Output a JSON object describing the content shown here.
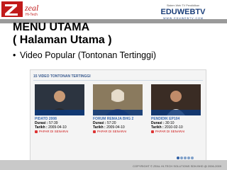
{
  "logos": {
    "left_text": "zeal",
    "left_sub": "Hi-Tech",
    "left_company": "ZEAL HI-TECH SOLUTIONS SDN. BHD.",
    "right_tagline": "Sistem Web TV Pendidikan",
    "right_brand": "EDUWEBTV",
    "right_url": "W W W . E D U W E B T V . C O M"
  },
  "slide": {
    "title_line1": "MENU UTAMA",
    "title_line2": "( Halaman Utama )",
    "bullet": "Video Popular (Tontonan Tertinggi)"
  },
  "screenshot": {
    "section_header": "15 VIDEO TONTONAN TERTINGGI",
    "cards": [
      {
        "title": "PIDATO 2008",
        "duration_label": "Durasi :",
        "duration": "57:39",
        "date_label": "Tarikh :",
        "date": "2009-04-10",
        "play_label": "PAPAR DI SENARAI"
      },
      {
        "title": "FORUM REMAJA BHG 2",
        "duration_label": "Durasi :",
        "duration": "57:20",
        "date_label": "Tarikh :",
        "date": "2009-04-10",
        "play_label": "PAPAR DI SENARAI"
      },
      {
        "title": "PENDIDIK EP104",
        "duration_label": "Durasi :",
        "duration": "30:10",
        "date_label": "Tarikh :",
        "date": "2010-02-10",
        "play_label": "PAPAR DI SENARAI"
      }
    ]
  },
  "footer": {
    "copyright": "COPYRIGHT © ZEAL HI-TECH SOLUTIONS SDN BHD @ 2006-2009"
  },
  "colors": {
    "brand_red": "#c11a1a",
    "brand_blue": "#1b3f7a",
    "link_blue": "#3b6db3"
  }
}
